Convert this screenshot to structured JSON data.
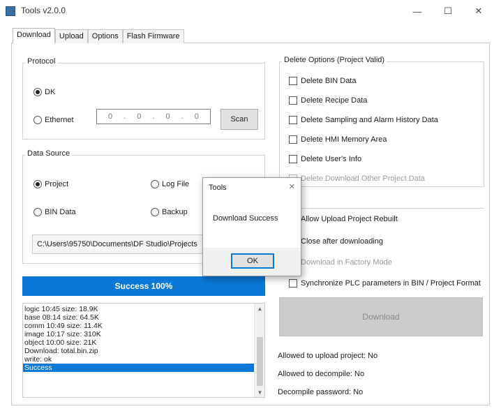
{
  "window": {
    "title": "Tools v2.0.0",
    "minimize": "—",
    "maximize": "☐",
    "close": "✕"
  },
  "tabs": [
    "Download",
    "Upload",
    "Options",
    "Flash Firmware"
  ],
  "protocol": {
    "legend": "Protocol",
    "options": [
      "DK",
      "Ethernet"
    ],
    "selected": "DK",
    "ip_segments": [
      "0",
      ".",
      "0",
      ".",
      "0",
      ".",
      "0"
    ],
    "scan_button": "Scan"
  },
  "data_source": {
    "legend": "Data Source",
    "options": [
      "Project",
      "Log File",
      "BIN Data",
      "Backup"
    ],
    "selected": "Project",
    "path": "C:\\Users\\95750\\Documents\\DF Studio\\Projects"
  },
  "progress": {
    "label": "Success 100%",
    "percent": 100,
    "color": "#0a78d7"
  },
  "log": {
    "lines": [
      "logic 10:45    size: 18.9K",
      "base 08:14    size: 64.5K",
      "comm 10:49    size: 11.4K",
      "image 10:17    size: 310K",
      "object 10:00    size: 21K",
      "Download: total.bin.zip",
      "write: ok",
      "Success"
    ],
    "selected_index": 7
  },
  "delete_options": {
    "legend": "Delete Options (Project Valid)",
    "items": [
      {
        "label": "Delete BIN Data",
        "enabled": true
      },
      {
        "label": "Delete Recipe Data",
        "enabled": true
      },
      {
        "label": "Delete Sampling and Alarm History Data",
        "enabled": true
      },
      {
        "label": "Delete HMI Memory Area",
        "enabled": true
      },
      {
        "label": "Delete User's Info",
        "enabled": true
      },
      {
        "label": "Delete Download Other Project Data",
        "enabled": false
      }
    ]
  },
  "upload_options": {
    "items": [
      {
        "label": "Allow Upload Project Rebuilt",
        "enabled": true
      },
      {
        "label": "Close after downloading",
        "enabled": true
      },
      {
        "label": "Download in Factory Mode",
        "enabled": false
      },
      {
        "label": "Synchronize PLC parameters in BIN / Project Format",
        "enabled": true
      }
    ]
  },
  "download_button": "Download",
  "info": [
    "Allowed to upload project: No",
    "Allowed to decompile: No",
    "Decompile password: No"
  ],
  "dialog": {
    "title": "Tools",
    "close": "✕",
    "message": "Download Success",
    "ok": "OK"
  }
}
